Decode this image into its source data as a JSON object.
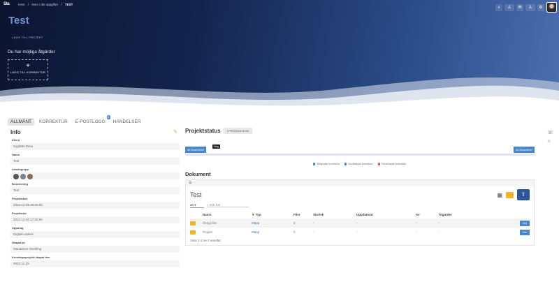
{
  "topbar": {
    "logo": "Sta",
    "breadcrumb": [
      "Hem",
      "Hem i din uppgifter",
      "TEST"
    ],
    "icons": [
      "search-icon",
      "user-icon",
      "bell-icon",
      "users-icon",
      "gear-icon"
    ]
  },
  "hero": {
    "title": "Test",
    "subtitle": "LÄGG TILL PROJEKT",
    "actions_heading": "Du har möjliga åtgärder",
    "add_plus": "+",
    "add_label": "LÄGG TILL KORREKTUR"
  },
  "tabs": [
    {
      "label": "ALLMÄNT",
      "active": true
    },
    {
      "label": "KORREKTUR"
    },
    {
      "label": "E-POSTLOGG",
      "badge": "0"
    },
    {
      "label": "HÄNDELSER"
    }
  ],
  "info": {
    "title": "Info",
    "fields": [
      {
        "label": "Klient",
        "value": "Kygfatta Desu"
      },
      {
        "label": "Namn",
        "value": "Test"
      },
      {
        "label": "Arbetsgrupp",
        "value": ""
      },
      {
        "label": "Beskrivning",
        "value": "Test"
      },
      {
        "label": "Projektstart",
        "value": "2022-12-05 00:00:00"
      },
      {
        "label": "Projektslut",
        "value": "2022-12-20 17:00:00"
      },
      {
        "label": "Uppdrag",
        "value": "Digitalt utskick"
      },
      {
        "label": "Skapat av",
        "value": "Mandatore Workling"
      },
      {
        "label": "Kunskapsprojekt skapat den",
        "value": "2022-11-25"
      }
    ]
  },
  "project_status": {
    "title": "Projektstatus",
    "badge": "I PRODUKTION",
    "start": "05 December",
    "end": "20 December",
    "tooltip": "Idag",
    "legend": [
      {
        "label": "Skapade korrektur",
        "color": "#4a86c8"
      },
      {
        "label": "Godkända korrektur",
        "color": "#4a86c8"
      },
      {
        "label": "Försenade korrektur",
        "color": "#e05555"
      }
    ]
  },
  "documents": {
    "title": "Dokument",
    "toolbar": "☰",
    "folder_name": "Test",
    "page_size": "20",
    "search_placeholder": "Sök här",
    "columns": [
      "",
      "Namn",
      "Typ",
      "Filer",
      "Storlek",
      "Uppdaterat",
      "Av",
      "Åtgärder",
      ""
    ],
    "rows": [
      {
        "name": "Övrigt filer",
        "type": "Mapp",
        "files": "0",
        "size": "-",
        "updated": "-",
        "by": "-",
        "actions": "-",
        "button": "Info"
      },
      {
        "name": "Projekt",
        "type": "Mapp",
        "files": "0",
        "size": "-",
        "updated": "-",
        "by": "-",
        "actions": "-",
        "button": "Info"
      }
    ],
    "count_text": "Visar 1-2 av 2 resultat"
  },
  "colors": {
    "accent": "#4a86c8",
    "folder": "#f0b429",
    "hero_dark": "#0b1530"
  }
}
